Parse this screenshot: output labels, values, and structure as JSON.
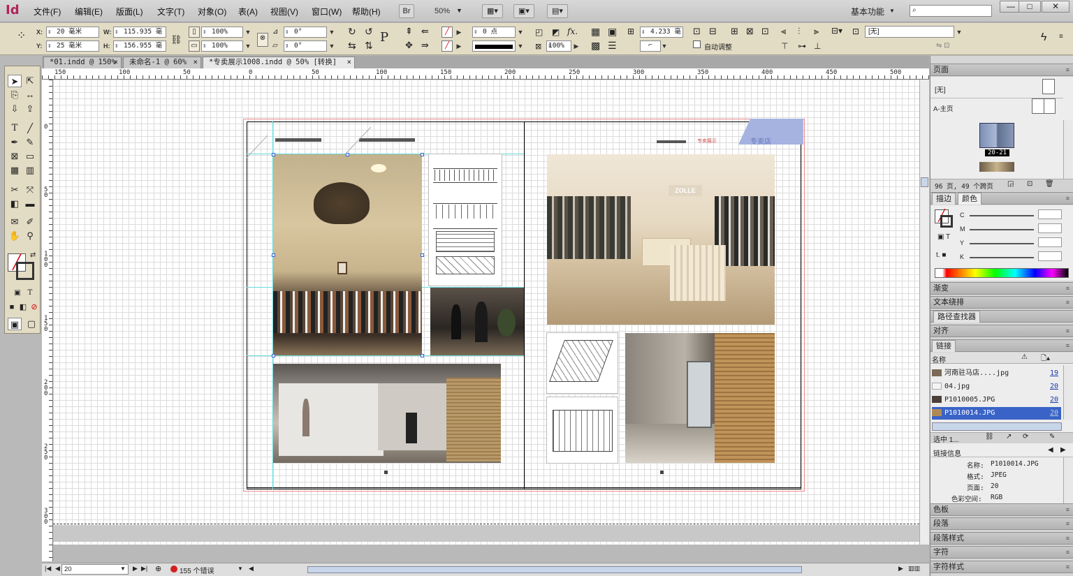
{
  "app": {
    "logo": "Id"
  },
  "menu": [
    "文件(F)",
    "编辑(E)",
    "版面(L)",
    "文字(T)",
    "对象(O)",
    "表(A)",
    "视图(V)",
    "窗口(W)",
    "帮助(H)"
  ],
  "toolbar_top": {
    "bridge_label": "Br",
    "zoom": "50%",
    "workspace": "基本功能"
  },
  "control": {
    "x_label": "X:",
    "x": "20 毫米",
    "y_label": "Y:",
    "y": "25 毫米",
    "w_label": "W:",
    "w": "115.935 毫",
    "h_label": "H:",
    "h": "156.955 毫",
    "scale_x": "100%",
    "scale_y": "100%",
    "rotate": "0°",
    "shear": "0°",
    "stroke_weight": "0 点",
    "opacity": "100%",
    "gap": "4.233 毫",
    "autofit": "自动调整",
    "style": "[无]"
  },
  "tabs": [
    "*01.indd @ 150%",
    "未命名-1 @ 60%",
    "*专卖展示1008.indd @ 50% [转换]"
  ],
  "rulers": {
    "h": [
      "150",
      "100",
      "50",
      "0",
      "50",
      "100",
      "150",
      "200",
      "250",
      "300",
      "350",
      "400",
      "450",
      "500"
    ],
    "v": [
      "0",
      "5 0",
      "1 0 0",
      "1 5 0",
      "2 0 0",
      "2 5 0",
      "3 0 0"
    ]
  },
  "document": {
    "brand_tag": "专卖展示",
    "corner_label": "专卖店",
    "storefront_sign": "ZOLLE"
  },
  "panels": {
    "pages": {
      "title": "页面",
      "none_master": "[无]",
      "a_master": "A-主页",
      "spread_label": "20-21",
      "summary": "96 页, 49 个跨页"
    },
    "stroke_tab": "描边",
    "color_tab": "颜色",
    "cmyk": [
      "C",
      "M",
      "Y",
      "K"
    ],
    "gradient": "渐变",
    "text_wrap": "文本绕排",
    "pathfinder": "路径查找器",
    "align": "对齐",
    "links": {
      "title": "链接",
      "col_name": "名称",
      "rows": [
        {
          "name": "河南驻马店....jpg",
          "page": "19"
        },
        {
          "name": "04.jpg",
          "page": "20"
        },
        {
          "name": "P1010005.JPG",
          "page": "20"
        },
        {
          "name": "P1010014.JPG",
          "page": "20"
        }
      ],
      "selected": "选中 1...",
      "info_title": "链接信息",
      "info": [
        {
          "k": "名称:",
          "v": "P1010014.JPG"
        },
        {
          "k": "格式:",
          "v": "JPEG"
        },
        {
          "k": "页面:",
          "v": "20"
        },
        {
          "k": "色彩空间:",
          "v": "RGB"
        }
      ]
    },
    "swatches": "色板",
    "paragraph": "段落",
    "paragraph_styles": "段落样式",
    "character": "字符",
    "character_styles": "字符样式"
  },
  "status": {
    "page": "20",
    "errors": "155 个错误"
  }
}
